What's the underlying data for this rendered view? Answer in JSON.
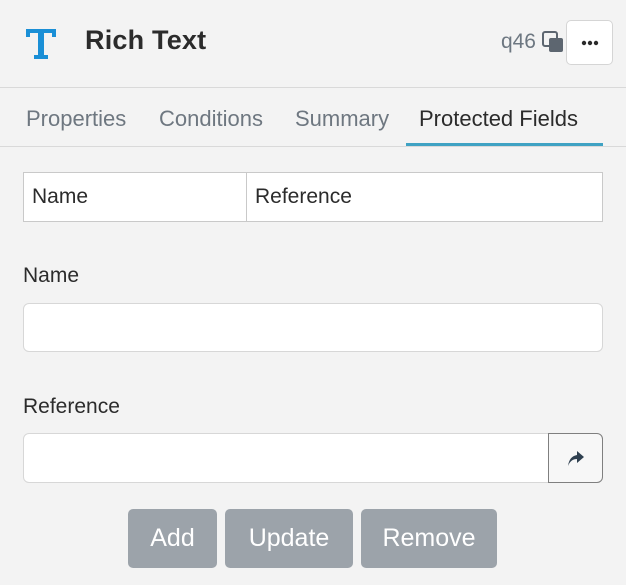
{
  "header": {
    "title": "Rich Text",
    "question_id": "q46",
    "type_icon": "text-type-icon",
    "copy_icon": "copy-icon",
    "more_icon": "ellipsis-icon"
  },
  "tabs": [
    {
      "label": "Properties",
      "active": false
    },
    {
      "label": "Conditions",
      "active": false
    },
    {
      "label": "Summary",
      "active": false
    },
    {
      "label": "Protected Fields",
      "active": true
    }
  ],
  "table": {
    "columns": [
      "Name",
      "Reference"
    ]
  },
  "form": {
    "name_label": "Name",
    "name_value": "",
    "reference_label": "Reference",
    "reference_value": "",
    "reference_button_icon": "arrow-link-icon"
  },
  "buttons": {
    "add": "Add",
    "update": "Update",
    "remove": "Remove"
  },
  "colors": {
    "accent": "#3fa2c3",
    "icon_blue": "#1a8fd6",
    "disabled_button": "#9ca3aa",
    "background": "#f3f3f3"
  }
}
